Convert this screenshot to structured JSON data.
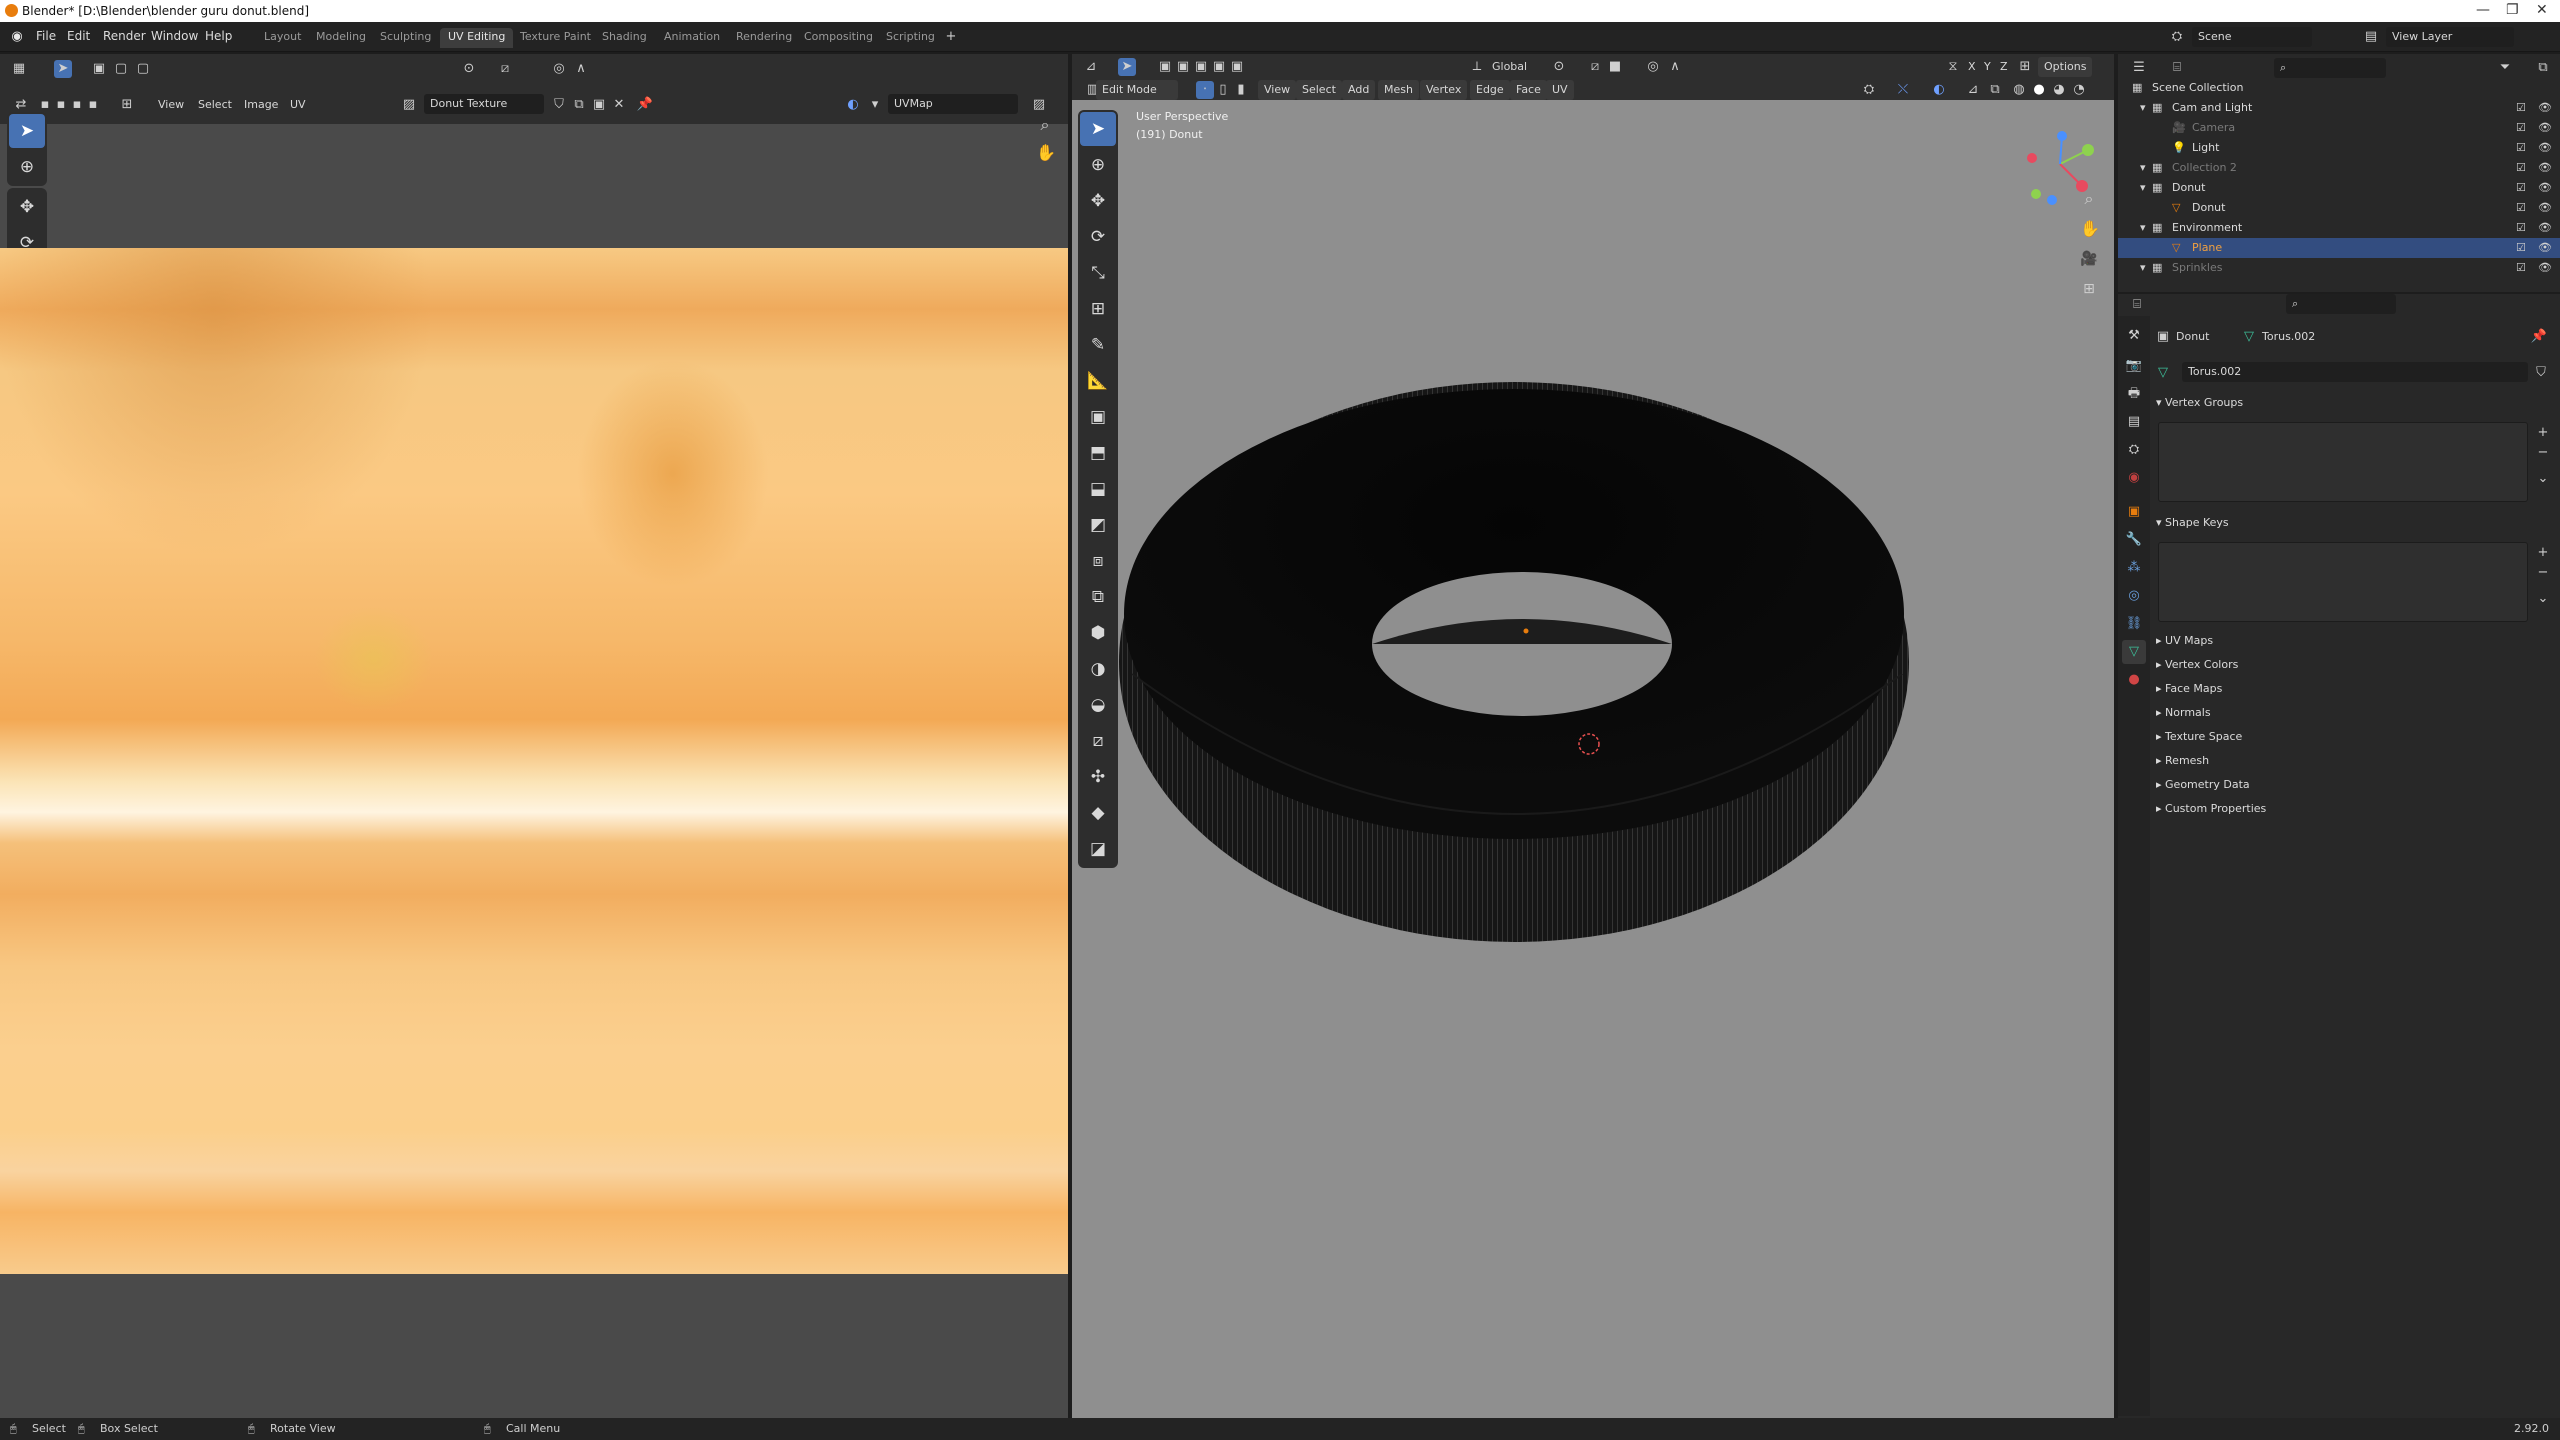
{
  "window": {
    "title": "Blender* [D:\\Blender\\blender guru donut.blend]",
    "controls": [
      "—",
      "❐",
      "✕"
    ]
  },
  "menu": [
    "File",
    "Edit",
    "Render",
    "Window",
    "Help"
  ],
  "workspaces": [
    "Layout",
    "Modeling",
    "Sculpting",
    "UV Editing",
    "Texture Paint",
    "Shading",
    "Animation",
    "Rendering",
    "Compositing",
    "Scripting"
  ],
  "active_workspace": "UV Editing",
  "scene": {
    "label": "Scene",
    "view_layer": "View Layer"
  },
  "uv_editor": {
    "menus": [
      "View",
      "Select",
      "Image",
      "UV"
    ],
    "image_name": "Donut Texture",
    "uv_map": "UVMap"
  },
  "viewport": {
    "mode": "Edit Mode",
    "menus": [
      "View",
      "Select",
      "Add",
      "Mesh",
      "Vertex",
      "Edge",
      "Face",
      "UV"
    ],
    "transform_orientation": "Global",
    "options_label": "Options",
    "overlay_title": "User Perspective",
    "overlay_object": "(191) Donut",
    "axis_labels": {
      "x": "X",
      "y": "Y",
      "z": "Z"
    }
  },
  "outliner": {
    "rows": [
      {
        "label": "Scene Collection",
        "level": 0,
        "icon": "collection-icon"
      },
      {
        "label": "Cam and Light",
        "level": 1,
        "icon": "collection-icon"
      },
      {
        "label": "Camera",
        "level": 2,
        "icon": "camera-icon",
        "dim": true
      },
      {
        "label": "Light",
        "level": 2,
        "icon": "light-icon"
      },
      {
        "label": "Collection 2",
        "level": 1,
        "icon": "collection-icon",
        "dim": true
      },
      {
        "label": "Donut",
        "level": 1,
        "icon": "collection-icon"
      },
      {
        "label": "Donut",
        "level": 2,
        "icon": "mesh-icon"
      },
      {
        "label": "Environment",
        "level": 1,
        "icon": "collection-icon"
      },
      {
        "label": "Plane",
        "level": 2,
        "icon": "mesh-icon",
        "selected": true
      },
      {
        "label": "Sprinkles",
        "level": 1,
        "icon": "collection-icon",
        "dim": true
      }
    ]
  },
  "properties": {
    "breadcrumb_object": "Donut",
    "breadcrumb_mesh": "Torus.002",
    "mesh_name": "Torus.002",
    "panels_open": [
      "Vertex Groups",
      "Shape Keys"
    ],
    "panels_closed": [
      "UV Maps",
      "Vertex Colors",
      "Face Maps",
      "Normals",
      "Texture Space",
      "Remesh",
      "Geometry Data",
      "Custom Properties"
    ]
  },
  "statusbar": {
    "items": [
      "Select",
      "Box Select",
      "Rotate View",
      "Call Menu"
    ],
    "version": "2.92.0"
  },
  "colors": {
    "accent": "#4772b3",
    "selection_orange": "#e87d0d",
    "viewport_bg": "#8f8f8f",
    "editor_bg": "#282828"
  }
}
